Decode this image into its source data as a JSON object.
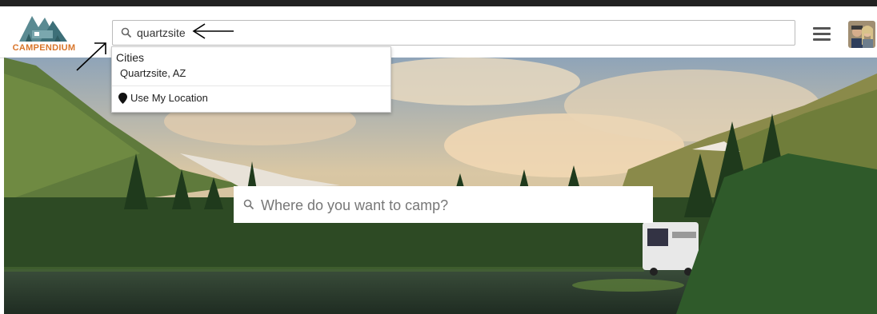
{
  "brand": {
    "name": "CAMPENDIUM",
    "color": "#d8752a"
  },
  "header": {
    "search_value": "quartzsite",
    "search_icon": "search-icon",
    "menu_icon": "hamburger-menu-icon",
    "avatar": "user-avatar"
  },
  "dropdown": {
    "heading": "Cities",
    "items": [
      {
        "label": "Quartzsite, AZ"
      }
    ],
    "location_label": "Use My Location",
    "location_icon": "map-pin-icon"
  },
  "hero": {
    "search_placeholder": "Where do you want to camp?",
    "scene": "mountain-lake-rv-landscape"
  }
}
